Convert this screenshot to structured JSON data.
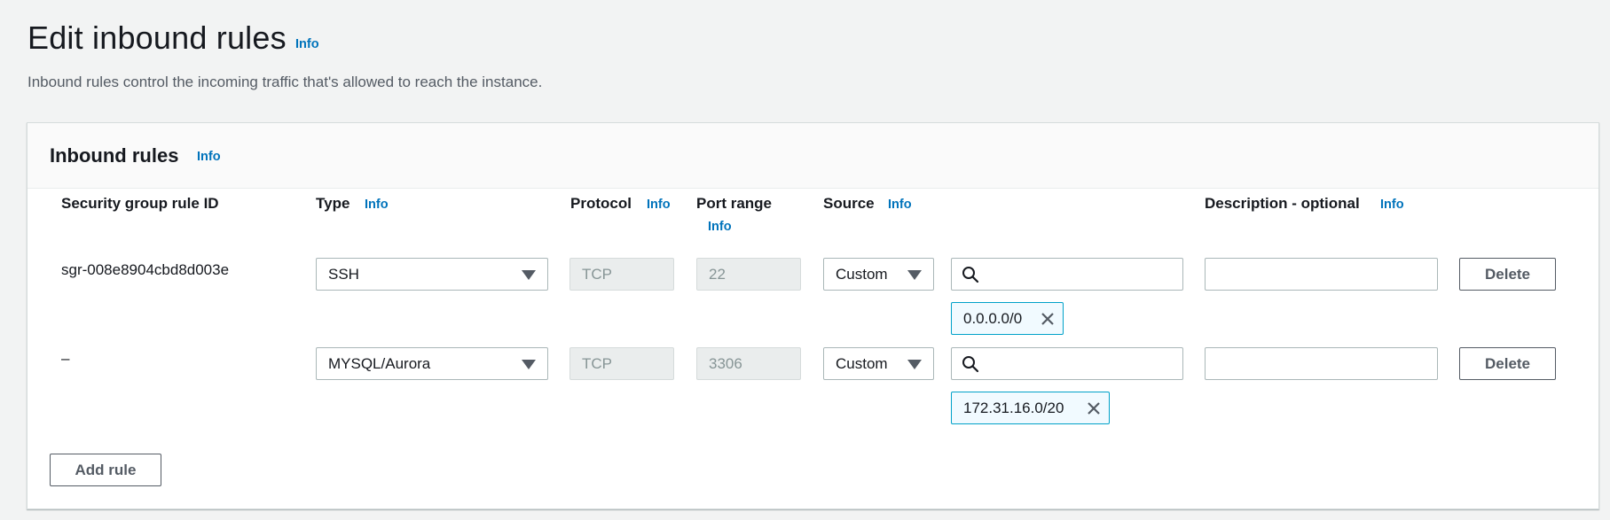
{
  "page": {
    "title": "Edit inbound rules",
    "info": "Info",
    "description": "Inbound rules control the incoming traffic that's allowed to reach the instance."
  },
  "panel": {
    "title": "Inbound rules",
    "info": "Info"
  },
  "columns": {
    "rule_id": "Security group rule ID",
    "type": "Type",
    "type_info": "Info",
    "protocol": "Protocol",
    "protocol_info": "Info",
    "port_range": "Port range",
    "port_range_info": "Info",
    "source": "Source",
    "source_info": "Info",
    "description": "Description - optional",
    "description_info": "Info"
  },
  "rules": [
    {
      "rule_id": "sgr-008e8904cbd8d003e",
      "type": "SSH",
      "protocol": "TCP",
      "port_range": "22",
      "source_mode": "Custom",
      "source_search": "",
      "source_token": "0.0.0.0/0",
      "description": "",
      "delete_label": "Delete"
    },
    {
      "rule_id": "–",
      "type": "MYSQL/Aurora",
      "protocol": "TCP",
      "port_range": "3306",
      "source_mode": "Custom",
      "source_search": "",
      "source_token": "172.31.16.0/20",
      "description": "",
      "delete_label": "Delete"
    }
  ],
  "actions": {
    "add_rule": "Add rule"
  },
  "icons": {
    "search": "search-icon",
    "dropdown": "caret-down-icon",
    "remove_token": "close-icon"
  },
  "colors": {
    "link": "#0073bb",
    "token_border": "#00a1c9",
    "page_bg": "#f2f3f3"
  }
}
